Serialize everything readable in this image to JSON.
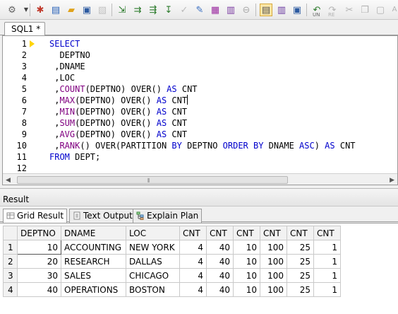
{
  "editor_tab": {
    "label": "SQL1 *"
  },
  "gutter": {
    "lines": [
      "1",
      "2",
      "3",
      "4",
      "5",
      "6",
      "7",
      "8",
      "9",
      "10",
      "11",
      "12"
    ]
  },
  "code": {
    "lines": [
      [
        {
          "t": "SELECT",
          "c": "kw"
        }
      ],
      [
        {
          "t": "  DEPTNO",
          "c": ""
        }
      ],
      [
        {
          "t": " ,DNAME",
          "c": ""
        }
      ],
      [
        {
          "t": " ,LOC",
          "c": ""
        }
      ],
      [
        {
          "t": " ,",
          "c": ""
        },
        {
          "t": "COUNT",
          "c": "fn"
        },
        {
          "t": "(DEPTNO) OVER() ",
          "c": ""
        },
        {
          "t": "AS",
          "c": "kw"
        },
        {
          "t": " CNT",
          "c": ""
        }
      ],
      [
        {
          "t": " ,",
          "c": ""
        },
        {
          "t": "MAX",
          "c": "fn"
        },
        {
          "t": "(DEPTNO) OVER() ",
          "c": ""
        },
        {
          "t": "AS",
          "c": "kw"
        },
        {
          "t": " CNT",
          "c": ""
        },
        {
          "t": "|",
          "c": "caret"
        }
      ],
      [
        {
          "t": " ,",
          "c": ""
        },
        {
          "t": "MIN",
          "c": "fn"
        },
        {
          "t": "(DEPTNO) OVER() ",
          "c": ""
        },
        {
          "t": "AS",
          "c": "kw"
        },
        {
          "t": " CNT",
          "c": ""
        }
      ],
      [
        {
          "t": " ,",
          "c": ""
        },
        {
          "t": "SUM",
          "c": "fn"
        },
        {
          "t": "(DEPTNO) OVER() ",
          "c": ""
        },
        {
          "t": "AS",
          "c": "kw"
        },
        {
          "t": " CNT",
          "c": ""
        }
      ],
      [
        {
          "t": " ,",
          "c": ""
        },
        {
          "t": "AVG",
          "c": "fn"
        },
        {
          "t": "(DEPTNO) OVER() ",
          "c": ""
        },
        {
          "t": "AS",
          "c": "kw"
        },
        {
          "t": " CNT",
          "c": ""
        }
      ],
      [
        {
          "t": " ,",
          "c": ""
        },
        {
          "t": "RANK",
          "c": "fn"
        },
        {
          "t": "() OVER(PARTITION ",
          "c": ""
        },
        {
          "t": "BY",
          "c": "kw"
        },
        {
          "t": " DEPTNO ",
          "c": ""
        },
        {
          "t": "ORDER BY",
          "c": "kw"
        },
        {
          "t": " DNAME ",
          "c": ""
        },
        {
          "t": "ASC",
          "c": "kw"
        },
        {
          "t": ") ",
          "c": ""
        },
        {
          "t": "AS",
          "c": "kw"
        },
        {
          "t": " CNT",
          "c": ""
        }
      ],
      [
        {
          "t": "FROM",
          "c": "kw"
        },
        {
          "t": " DEPT;",
          "c": ""
        }
      ],
      []
    ]
  },
  "result": {
    "title": "Result",
    "tabs": [
      "Grid Result",
      "Text Output",
      "Explain Plan"
    ],
    "columns": [
      "DEPTNO",
      "DNAME",
      "LOC",
      "CNT",
      "CNT",
      "CNT",
      "CNT",
      "CNT",
      "CNT"
    ],
    "rows": [
      [
        "1",
        "10",
        "ACCOUNTING",
        "NEW YORK",
        "4",
        "40",
        "10",
        "100",
        "25",
        "1"
      ],
      [
        "2",
        "20",
        "RESEARCH",
        "DALLAS",
        "4",
        "40",
        "10",
        "100",
        "25",
        "1"
      ],
      [
        "3",
        "30",
        "SALES",
        "CHICAGO",
        "4",
        "40",
        "10",
        "100",
        "25",
        "1"
      ],
      [
        "4",
        "40",
        "OPERATIONS",
        "BOSTON",
        "4",
        "40",
        "10",
        "100",
        "25",
        "1"
      ]
    ]
  },
  "colors": {
    "keyword": "#0000cc",
    "function": "#800080",
    "current_line_marker": "#ffd400"
  }
}
